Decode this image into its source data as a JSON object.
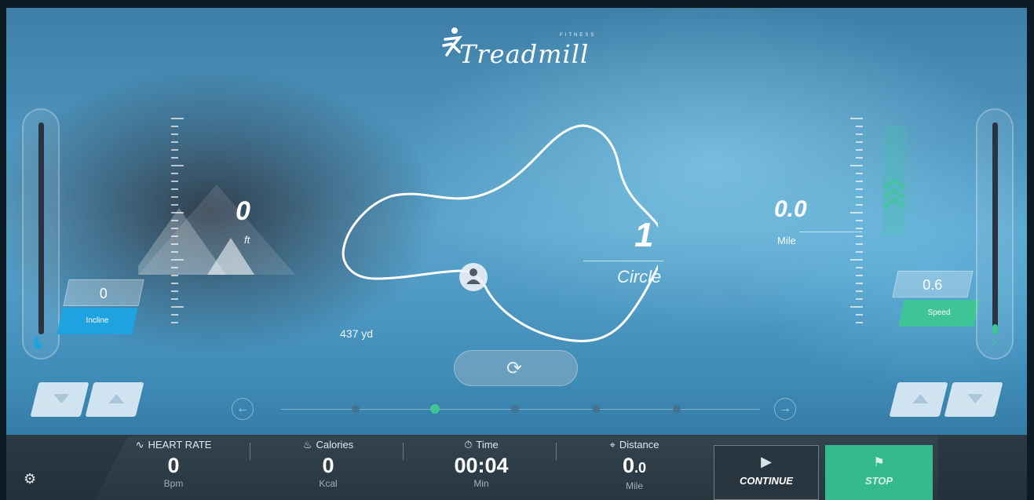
{
  "logo": {
    "brand": "Treadmill",
    "sub": "FITNESS"
  },
  "incline": {
    "value": "0",
    "tag": "Incline",
    "elevation_value": "0",
    "elevation_unit": "ft",
    "level_fraction": 0.0
  },
  "speed": {
    "value": "0.6",
    "tag": "Speed",
    "distance_value": "0.0",
    "distance_unit": "Mile",
    "level_fraction": 0.05
  },
  "track": {
    "laps": "1",
    "laps_label": "Circle",
    "length": "437 yd"
  },
  "pager": {
    "prev": "←",
    "next": "→",
    "active_index": 1,
    "count": 5
  },
  "stats": {
    "heart_rate": {
      "label": "HEART RATE",
      "value": "0",
      "unit": "Bpm"
    },
    "calories": {
      "label": "Calories",
      "value": "0",
      "unit": "Kcal"
    },
    "time": {
      "label": "Time",
      "value": "00:04",
      "unit": "Min"
    },
    "distance": {
      "label": "Distance",
      "value_main": "0",
      "value_frac": ".0",
      "unit": "Mile"
    }
  },
  "buttons": {
    "continue": "CONTINUE",
    "stop": "STOP"
  },
  "colors": {
    "accent_green": "#3fc495",
    "incline_blue": "#1fa3e0",
    "panel_dark": "#2c3a46"
  }
}
